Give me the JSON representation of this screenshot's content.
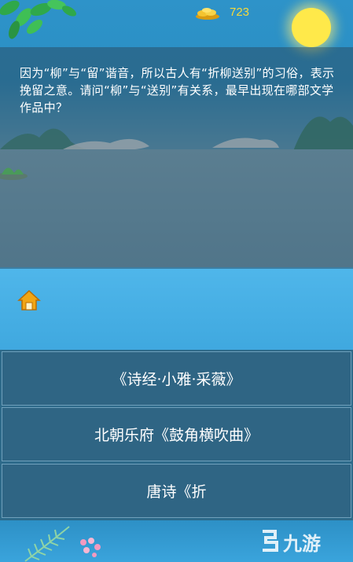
{
  "header": {
    "coin_count": "723"
  },
  "question": {
    "text": "因为“柳”与“留”谐音，所以古人有“折柳送别”的习俗，表示挽留之意。请问“柳”与“送别”有关系，最早出现在哪部文学作品中？"
  },
  "answers": [
    {
      "label": "《诗经·小雅·采薇》"
    },
    {
      "label": "北朝乐府《鼓角横吹曲》"
    },
    {
      "label": "唐诗《折"
    }
  ],
  "watermark": {
    "text": "九游"
  },
  "icons": {
    "coin": "gold-ingot-coins-icon",
    "home": "home-icon",
    "sun": "sun-icon",
    "leaves": "leaves-decoration-icon",
    "flowers": "pink-flowers-icon",
    "watermark_logo": "jiuyou-logo-icon"
  },
  "colors": {
    "coin_text": "#f6d93a",
    "answer_bg": "#2f6584",
    "answer_border": "#6fa0bb",
    "sun": "#ffe94a",
    "home_roof": "#f2a614"
  }
}
